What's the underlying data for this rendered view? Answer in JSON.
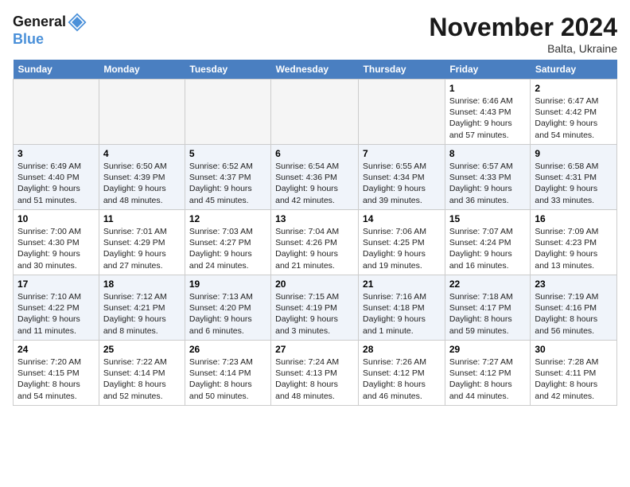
{
  "header": {
    "logo_line1": "General",
    "logo_line2": "Blue",
    "month_title": "November 2024",
    "subtitle": "Balta, Ukraine"
  },
  "weekdays": [
    "Sunday",
    "Monday",
    "Tuesday",
    "Wednesday",
    "Thursday",
    "Friday",
    "Saturday"
  ],
  "weeks": [
    [
      {
        "day": "",
        "info": ""
      },
      {
        "day": "",
        "info": ""
      },
      {
        "day": "",
        "info": ""
      },
      {
        "day": "",
        "info": ""
      },
      {
        "day": "",
        "info": ""
      },
      {
        "day": "1",
        "info": "Sunrise: 6:46 AM\nSunset: 4:43 PM\nDaylight: 9 hours and 57 minutes."
      },
      {
        "day": "2",
        "info": "Sunrise: 6:47 AM\nSunset: 4:42 PM\nDaylight: 9 hours and 54 minutes."
      }
    ],
    [
      {
        "day": "3",
        "info": "Sunrise: 6:49 AM\nSunset: 4:40 PM\nDaylight: 9 hours and 51 minutes."
      },
      {
        "day": "4",
        "info": "Sunrise: 6:50 AM\nSunset: 4:39 PM\nDaylight: 9 hours and 48 minutes."
      },
      {
        "day": "5",
        "info": "Sunrise: 6:52 AM\nSunset: 4:37 PM\nDaylight: 9 hours and 45 minutes."
      },
      {
        "day": "6",
        "info": "Sunrise: 6:54 AM\nSunset: 4:36 PM\nDaylight: 9 hours and 42 minutes."
      },
      {
        "day": "7",
        "info": "Sunrise: 6:55 AM\nSunset: 4:34 PM\nDaylight: 9 hours and 39 minutes."
      },
      {
        "day": "8",
        "info": "Sunrise: 6:57 AM\nSunset: 4:33 PM\nDaylight: 9 hours and 36 minutes."
      },
      {
        "day": "9",
        "info": "Sunrise: 6:58 AM\nSunset: 4:31 PM\nDaylight: 9 hours and 33 minutes."
      }
    ],
    [
      {
        "day": "10",
        "info": "Sunrise: 7:00 AM\nSunset: 4:30 PM\nDaylight: 9 hours and 30 minutes."
      },
      {
        "day": "11",
        "info": "Sunrise: 7:01 AM\nSunset: 4:29 PM\nDaylight: 9 hours and 27 minutes."
      },
      {
        "day": "12",
        "info": "Sunrise: 7:03 AM\nSunset: 4:27 PM\nDaylight: 9 hours and 24 minutes."
      },
      {
        "day": "13",
        "info": "Sunrise: 7:04 AM\nSunset: 4:26 PM\nDaylight: 9 hours and 21 minutes."
      },
      {
        "day": "14",
        "info": "Sunrise: 7:06 AM\nSunset: 4:25 PM\nDaylight: 9 hours and 19 minutes."
      },
      {
        "day": "15",
        "info": "Sunrise: 7:07 AM\nSunset: 4:24 PM\nDaylight: 9 hours and 16 minutes."
      },
      {
        "day": "16",
        "info": "Sunrise: 7:09 AM\nSunset: 4:23 PM\nDaylight: 9 hours and 13 minutes."
      }
    ],
    [
      {
        "day": "17",
        "info": "Sunrise: 7:10 AM\nSunset: 4:22 PM\nDaylight: 9 hours and 11 minutes."
      },
      {
        "day": "18",
        "info": "Sunrise: 7:12 AM\nSunset: 4:21 PM\nDaylight: 9 hours and 8 minutes."
      },
      {
        "day": "19",
        "info": "Sunrise: 7:13 AM\nSunset: 4:20 PM\nDaylight: 9 hours and 6 minutes."
      },
      {
        "day": "20",
        "info": "Sunrise: 7:15 AM\nSunset: 4:19 PM\nDaylight: 9 hours and 3 minutes."
      },
      {
        "day": "21",
        "info": "Sunrise: 7:16 AM\nSunset: 4:18 PM\nDaylight: 9 hours and 1 minute."
      },
      {
        "day": "22",
        "info": "Sunrise: 7:18 AM\nSunset: 4:17 PM\nDaylight: 8 hours and 59 minutes."
      },
      {
        "day": "23",
        "info": "Sunrise: 7:19 AM\nSunset: 4:16 PM\nDaylight: 8 hours and 56 minutes."
      }
    ],
    [
      {
        "day": "24",
        "info": "Sunrise: 7:20 AM\nSunset: 4:15 PM\nDaylight: 8 hours and 54 minutes."
      },
      {
        "day": "25",
        "info": "Sunrise: 7:22 AM\nSunset: 4:14 PM\nDaylight: 8 hours and 52 minutes."
      },
      {
        "day": "26",
        "info": "Sunrise: 7:23 AM\nSunset: 4:14 PM\nDaylight: 8 hours and 50 minutes."
      },
      {
        "day": "27",
        "info": "Sunrise: 7:24 AM\nSunset: 4:13 PM\nDaylight: 8 hours and 48 minutes."
      },
      {
        "day": "28",
        "info": "Sunrise: 7:26 AM\nSunset: 4:12 PM\nDaylight: 8 hours and 46 minutes."
      },
      {
        "day": "29",
        "info": "Sunrise: 7:27 AM\nSunset: 4:12 PM\nDaylight: 8 hours and 44 minutes."
      },
      {
        "day": "30",
        "info": "Sunrise: 7:28 AM\nSunset: 4:11 PM\nDaylight: 8 hours and 42 minutes."
      }
    ]
  ]
}
